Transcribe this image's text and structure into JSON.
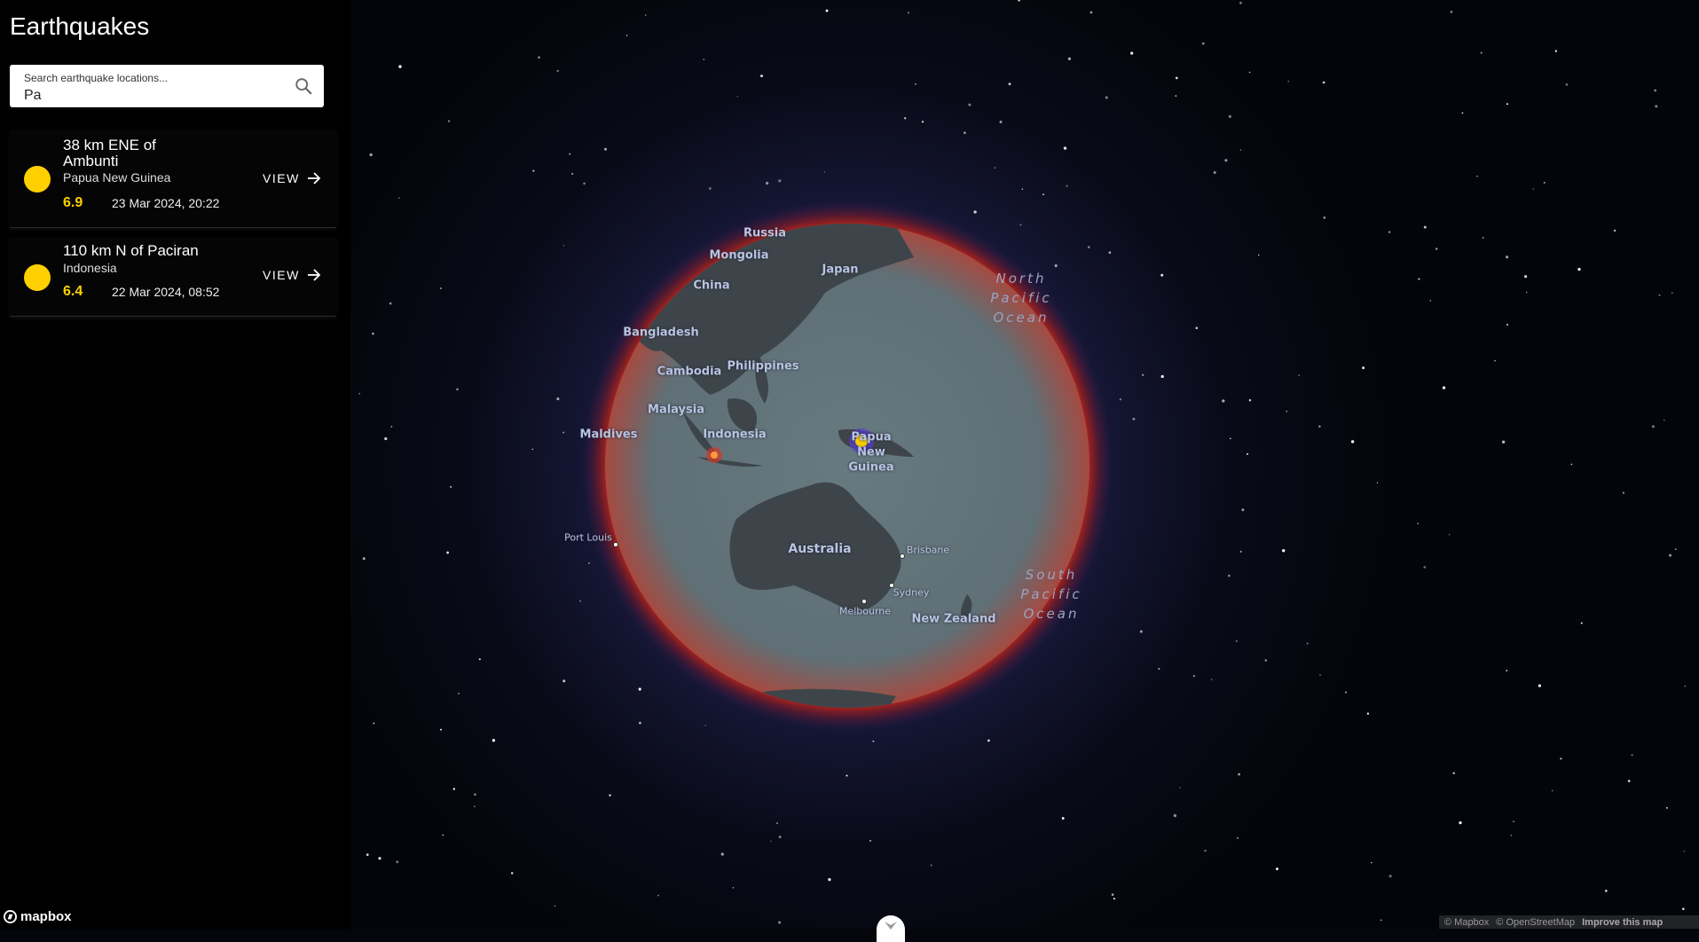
{
  "app": {
    "title": "Earthquakes"
  },
  "search": {
    "placeholder": "Search earthquake locations...",
    "value": "Pa"
  },
  "results": [
    {
      "place": "38 km ENE of Ambunti",
      "country": "Papua New Guinea",
      "magnitude": "6.9",
      "datetime": "23 Mar 2024, 20:22",
      "action": "VIEW"
    },
    {
      "place": "110 km N of Paciran",
      "country": "Indonesia",
      "magnitude": "6.4",
      "datetime": "22 Mar 2024, 08:52",
      "action": "VIEW"
    }
  ],
  "map": {
    "country_labels": [
      "Russia",
      "Mongolia",
      "Japan",
      "China",
      "Bangladesh",
      "Philippines",
      "Cambodia",
      "Malaysia",
      "Indonesia",
      "Maldives",
      "Papua New Guinea",
      "Australia",
      "New Zealand"
    ],
    "city_labels": [
      "Port Louis",
      "Brisbane",
      "Sydney",
      "Melbourne"
    ],
    "ocean_labels": [
      "North Pacific Ocean",
      "South Pacific Ocean"
    ],
    "quake_markers": [
      {
        "place": "38 km ENE of Ambunti",
        "magnitude": 6.9
      },
      {
        "place": "110 km N of Paciran",
        "magnitude": 6.4
      }
    ]
  },
  "footer": {
    "logo": "mapbox",
    "attribution": [
      "© Mapbox",
      "© OpenStreetMap",
      "Improve this map"
    ]
  },
  "colors": {
    "magnitude_yellow": "#ffd000",
    "atmosphere_red": "#c0241c",
    "globe_ocean": "#5e7178",
    "land": "#3d4449"
  }
}
